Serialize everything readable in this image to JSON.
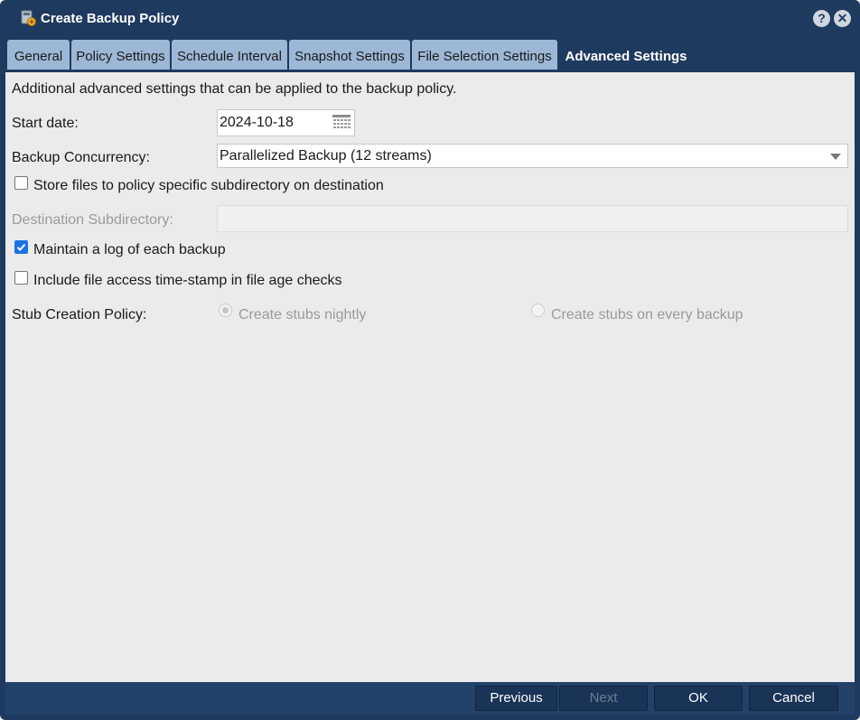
{
  "window": {
    "title": "Create Backup Policy",
    "help_icon": "question-icon",
    "close_icon": "close-icon"
  },
  "tabs": [
    {
      "label": "General",
      "active": false
    },
    {
      "label": "Policy Settings",
      "active": false
    },
    {
      "label": "Schedule Interval",
      "active": false
    },
    {
      "label": "Snapshot Settings",
      "active": false
    },
    {
      "label": "File Selection Settings",
      "active": false
    },
    {
      "label": "Advanced Settings",
      "active": true
    }
  ],
  "form": {
    "description": "Additional advanced settings that can be applied to the backup policy.",
    "start_date": {
      "label": "Start date:",
      "value": "2024-10-18"
    },
    "concurrency": {
      "label": "Backup Concurrency:",
      "value": "Parallelized Backup (12 streams)"
    },
    "store_subdir": {
      "label": "Store files to policy specific subdirectory on destination",
      "checked": false
    },
    "dest_subdir": {
      "label": "Destination Subdirectory:",
      "value": ""
    },
    "maintain_log": {
      "label": "Maintain a log of each backup",
      "checked": true
    },
    "access_timestamp": {
      "label": "Include file access time-stamp in file age checks",
      "checked": false
    },
    "stub_policy": {
      "label": "Stub Creation Policy:",
      "options": [
        {
          "label": "Create stubs nightly",
          "selected": true
        },
        {
          "label": "Create stubs on every backup",
          "selected": false
        }
      ]
    }
  },
  "footer": {
    "previous": "Previous",
    "next": "Next",
    "ok": "OK",
    "cancel": "Cancel"
  },
  "colors": {
    "chrome": "#1f3a5f",
    "tab_inactive": "#9cb8d6",
    "panel_bg": "#ebebeb",
    "checkbox_accent": "#1a73e8"
  }
}
